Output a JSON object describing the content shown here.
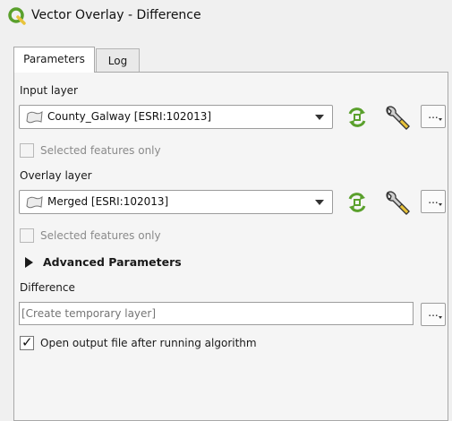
{
  "window": {
    "title": "Vector Overlay - Difference"
  },
  "tabs": [
    {
      "label": "Parameters",
      "active": true
    },
    {
      "label": "Log",
      "active": false
    }
  ],
  "input_layer": {
    "label": "Input layer",
    "value": "County_Galway [ESRI:102013]",
    "selected_only_label": "Selected features only",
    "selected_only_checked": false,
    "more_label": "..."
  },
  "overlay_layer": {
    "label": "Overlay layer",
    "value": "Merged [ESRI:102013]",
    "selected_only_label": "Selected features only",
    "selected_only_checked": false,
    "more_label": "..."
  },
  "advanced": {
    "label": "Advanced Parameters",
    "expanded": false
  },
  "output": {
    "label": "Difference",
    "placeholder": "[Create temporary layer]",
    "value": "",
    "more_label": "..."
  },
  "open_output": {
    "label": "Open output file after running algorithm",
    "checked": true
  },
  "icons": {
    "app": "qgis-logo-icon",
    "layer": "polygon-layer-icon",
    "iterate": "iterate-refresh-icon",
    "settings": "wrench-icon"
  },
  "colors": {
    "accent_green": "#5aa02c",
    "wrench_yellow": "#e8c33a"
  }
}
